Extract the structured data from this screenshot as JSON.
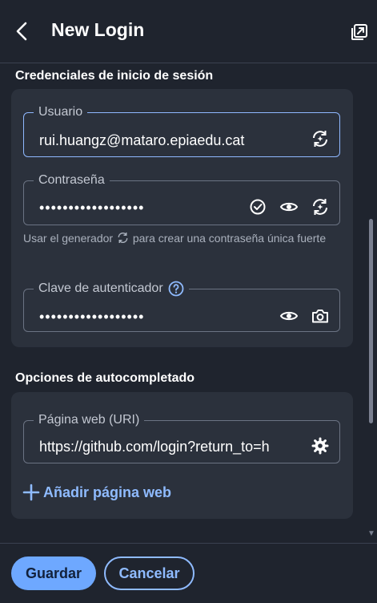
{
  "header": {
    "title": "New Login"
  },
  "credentials": {
    "section_title": "Credenciales de inicio de sesión",
    "username": {
      "label": "Usuario",
      "value": "rui.huangz@mataro.epiaedu.cat"
    },
    "password": {
      "label": "Contraseña",
      "value": "••••••••••••••••••"
    },
    "helper_prefix": "Usar el generador",
    "helper_suffix": "para crear una contraseña única fuerte",
    "authenticator": {
      "label": "Clave de autenticador",
      "value": "••••••••••••••••••"
    }
  },
  "autofill": {
    "section_title": "Opciones de autocompletado",
    "uri": {
      "label": "Página web (URI)",
      "value": "https://github.com/login?return_to=h"
    },
    "add_label": "Añadir página web"
  },
  "footer": {
    "save_label": "Guardar",
    "cancel_label": "Cancelar"
  },
  "colors": {
    "accent": "#8fbbff",
    "primary_button": "#6ea8ff",
    "background": "#1f242e",
    "card": "#2b313c"
  }
}
